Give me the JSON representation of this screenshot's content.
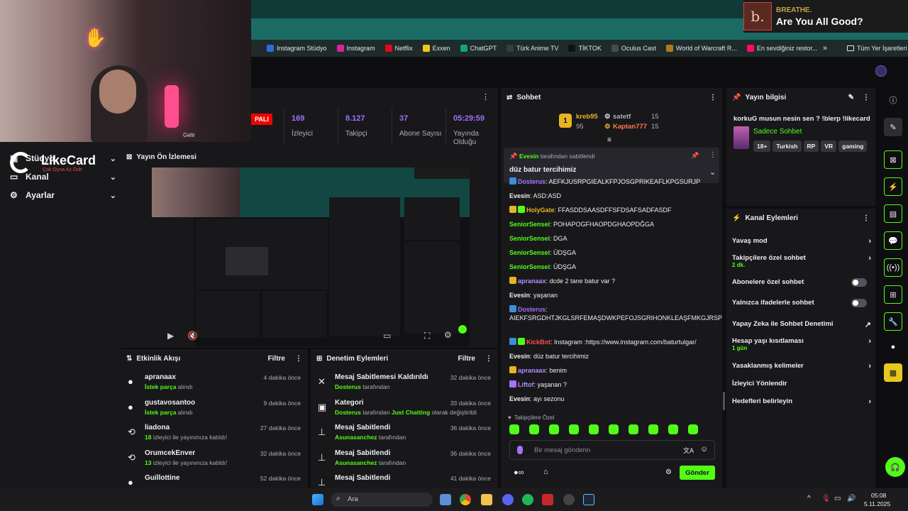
{
  "notification": {
    "artist": "BREATHE.",
    "track": "Are You All Good?",
    "art_letter": "b."
  },
  "bookmarks": [
    {
      "label": "Instagram Stüdyo",
      "color": "#2d6cdf"
    },
    {
      "label": "Instagram",
      "color": "#d6249f"
    },
    {
      "label": "Netflix",
      "color": "#e50914"
    },
    {
      "label": "Exxen",
      "color": "#f5c518"
    },
    {
      "label": "ChatGPT",
      "color": "#10a37f"
    },
    {
      "label": "Türk Anime TV",
      "color": "#3a3a3a"
    },
    {
      "label": "TİKTOK",
      "color": "#111111"
    },
    {
      "label": "Oculus Cast",
      "color": "#4a4a4a"
    },
    {
      "label": "World of Warcraft R...",
      "color": "#b07a20"
    },
    {
      "label": "En sevdiğiniz restor...",
      "color": "#ff0a6b"
    }
  ],
  "bookmarks_more": "»",
  "bookmarks_all": "Tüm Yer İşaretleri",
  "logo": {
    "name": "LikeCard",
    "tagline": "Çok Oyna Az Öde"
  },
  "leftnav": [
    {
      "label": "Stüdyo",
      "icon": "studio-icon"
    },
    {
      "label": "Kanal",
      "icon": "channel-icon"
    },
    {
      "label": "Ayarlar",
      "icon": "gear-icon"
    }
  ],
  "live_badge": "PALI",
  "webcam_label": "Gelir",
  "stats": [
    {
      "value": "",
      "label": "du Yayın"
    },
    {
      "value": "169",
      "label": "İzleyici"
    },
    {
      "value": "8.127",
      "label": "Takipçi"
    },
    {
      "value": "37",
      "label": "Abone Sayısı"
    },
    {
      "value": "05:29:59",
      "label": "Yayında Olduğu"
    }
  ],
  "preview": {
    "title": "Yayın Ön İzlemesi"
  },
  "activity": {
    "title": "Etkinlik Akışı",
    "filter": "Filtre",
    "rows": [
      {
        "user": "apranaax",
        "hl": "İstek parça",
        "rest": " alındı",
        "time": "4 dakika önce",
        "icon": "gift-icon"
      },
      {
        "user": "gustavosantoo",
        "hl": "İstek parça",
        "rest": " alındı",
        "time": "9 dakika önce",
        "icon": "gift-icon"
      },
      {
        "user": "liadona",
        "hl": "18",
        "rest": " izleyici ile yayınınıza katıldı!",
        "time": "27 dakika önce",
        "icon": "raid-icon"
      },
      {
        "user": "OrumcekEnver",
        "hl": "13",
        "rest": " izleyici ile yayınınıza katıldı!",
        "time": "32 dakika önce",
        "icon": "raid-icon"
      },
      {
        "user": "Guillottine",
        "hl": "",
        "rest": "",
        "time": "52 dakika önce",
        "icon": "gift-icon"
      }
    ]
  },
  "moderation": {
    "title": "Denetim Eylemleri",
    "filter": "Filtre",
    "rows": [
      {
        "title": "Mesaj Sabitlemesi Kaldırıldı",
        "user": "Dosterus",
        "rest": " tarafından",
        "time": "32 dakika önce",
        "icon": "unpin-icon"
      },
      {
        "title": "Kategori",
        "user": "Dosterus",
        "rest": " tarafından ",
        "hl2": "Just Chatting",
        "rest2": " olarak değiştirildi",
        "time": "33 dakika önce",
        "icon": "category-icon"
      },
      {
        "title": "Mesaj Sabitlendi",
        "user": "Asunasanchez",
        "rest": " tarafından",
        "time": "36 dakika önce",
        "icon": "pin-icon"
      },
      {
        "title": "Mesaj Sabitlendi",
        "user": "Asunasanchez",
        "rest": " tarafından",
        "time": "36 dakika önce",
        "icon": "pin-icon"
      },
      {
        "title": "Mesaj Sabitlendi",
        "user": "",
        "rest": "",
        "time": "41 dakika önce",
        "icon": "pin-icon"
      }
    ]
  },
  "chat": {
    "title": "Sohbet",
    "leaders": [
      {
        "name": "kreb95",
        "count": "95"
      },
      {
        "name": "satetf",
        "count": "15"
      },
      {
        "name": "Kaptan777",
        "count": "15"
      }
    ],
    "pinned": {
      "by": "Evesin",
      "by_suffix": "tarafından sabitlendi",
      "text": "düz batur tercihimiz"
    },
    "messages": [
      {
        "user": "Dosterus",
        "color": "v",
        "text": ": AEFKJUSRPGIEALKFPJOSGPRIKEAFLKPGSURJP"
      },
      {
        "user": "Evesin",
        "color": "w",
        "text": ": ASD:ASD"
      },
      {
        "user": "HolyGate",
        "color": "o",
        "text": ": FFASDDSAASDFFSFDSAFSADFASDF"
      },
      {
        "user": "SeniorSensei",
        "color": "g",
        "text": ": POHAPOGFHAOPDGHAOPDĞGA"
      },
      {
        "user": "SeniorSensei",
        "color": "g",
        "text": ": DGA"
      },
      {
        "user": "SeniorSensei",
        "color": "g",
        "text": ": ÜDŞGA"
      },
      {
        "user": "SeniorSensei",
        "color": "g",
        "text": ": ÜDŞGA"
      },
      {
        "user": "apranaax",
        "color": "p",
        "text": ": dcde 2 tane batur var ?"
      },
      {
        "user": "Evesin",
        "color": "w",
        "text": ": yaşanan"
      },
      {
        "user": "Dosterus",
        "color": "v",
        "text": ": AIEKFSRGDHTJKGLSRFEMAŞDWKPEFOJSGRIHONKLEAŞFMKGJRSPDHIOTRSEAFKPWDĞEFJOPGRSDHIT"
      },
      {
        "user": "KickBot",
        "color": "r",
        "text": ": Instagram :https://www.instagram.com/baturtulgar/"
      },
      {
        "user": "Evesin",
        "color": "w",
        "text": ": düz batur tercihimiz"
      },
      {
        "user": "apranaax",
        "color": "p",
        "text": ": benim"
      },
      {
        "user": "Liftof",
        "color": "p",
        "text": ": yaşanan ?"
      },
      {
        "user": "Evesin",
        "color": "w",
        "text": ": ayı sezonu"
      }
    ],
    "emote_label": "Takipçilere Özel",
    "input_placeholder": "Bir mesaj gönderin",
    "send": "Gönder"
  },
  "streaminfo": {
    "title": "Yayın bilgisi",
    "stream_title": "korkuG musun nesin sen ? !blerp !likecard",
    "category": "Sadece Sohbet",
    "tags": [
      "18+",
      "Turkish",
      "RP",
      "VR",
      "gaming"
    ]
  },
  "channel_actions": {
    "title": "Kanal Eylemleri",
    "rows": [
      {
        "label": "Yavaş mod",
        "sub": "",
        "ctrl": "chevron"
      },
      {
        "label": "Takipçilere özel sohbet",
        "sub": "2 dk.",
        "ctrl": "chevron"
      },
      {
        "label": "Abonelere özel sohbet",
        "sub": "",
        "ctrl": "toggle"
      },
      {
        "label": "Yalnızca ifadelerle sohbet",
        "sub": "",
        "ctrl": "toggle"
      },
      {
        "label": "Yapay Zeka ile Sohbet Denetimi",
        "sub": "",
        "ctrl": "external"
      },
      {
        "label": "Hesap yaşı kısıtlaması",
        "sub": "1 gün",
        "ctrl": "chevron"
      },
      {
        "label": "Yasaklanmış kelimeler",
        "sub": "",
        "ctrl": "chevron"
      },
      {
        "label": "İzleyici Yönlendir",
        "sub": "",
        "ctrl": "none"
      },
      {
        "label": "Hedefleri belirleyin",
        "sub": "",
        "ctrl": "chevron"
      }
    ]
  },
  "taskbar": {
    "search": "Ara",
    "time": "05:08",
    "date": "5.11.2025"
  }
}
